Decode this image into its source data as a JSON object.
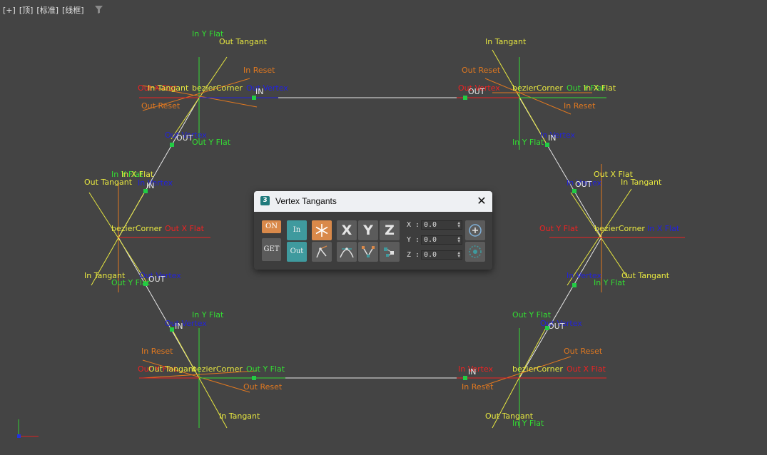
{
  "viewport": {
    "labels": [
      "[+]",
      "[顶]",
      "[标准]",
      "[线框]"
    ]
  },
  "scene": {
    "vertex_label": "bezierCorner",
    "in_label": "IN",
    "out_label": "OUT",
    "labels": {
      "in_y_flat": "In Y Flat",
      "out_y_flat": "Out Y Flat",
      "in_tangent": "In Tangant",
      "out_tangent": "Out Tangant",
      "in_reset": "In Reset",
      "out_reset": "Out Reset",
      "in_vertex": "In Vertex",
      "out_vertex": "Out Vertex",
      "in_x_flat": "In X Flat",
      "out_x_flat": "Out X Flat"
    },
    "colors": {
      "background": "#444444",
      "shape": "#e8e8e8",
      "tangent": "#e8e840",
      "y_flat": "#33dd33",
      "reset": "#e07820",
      "x_flat": "#ee2222",
      "vertex_ref": "#2222dd"
    }
  },
  "dialog": {
    "title": "Vertex Tangants",
    "app_icon": "3",
    "on_label": "ON",
    "get_label": "GET",
    "in_label": "In",
    "out_label": "Out",
    "x_label": "X",
    "y_label": "Y",
    "z_label": "Z",
    "x_field_label": "X",
    "y_field_label": "Y",
    "z_field_label": "Z",
    "x_value": "0.0",
    "y_value": "0.0",
    "z_value": "0.0",
    "colors": {
      "on": "#d9894a",
      "in_out": "#3f9a9e",
      "accent_icon": "#d9894a",
      "title_bar": "#eef0f3"
    }
  }
}
